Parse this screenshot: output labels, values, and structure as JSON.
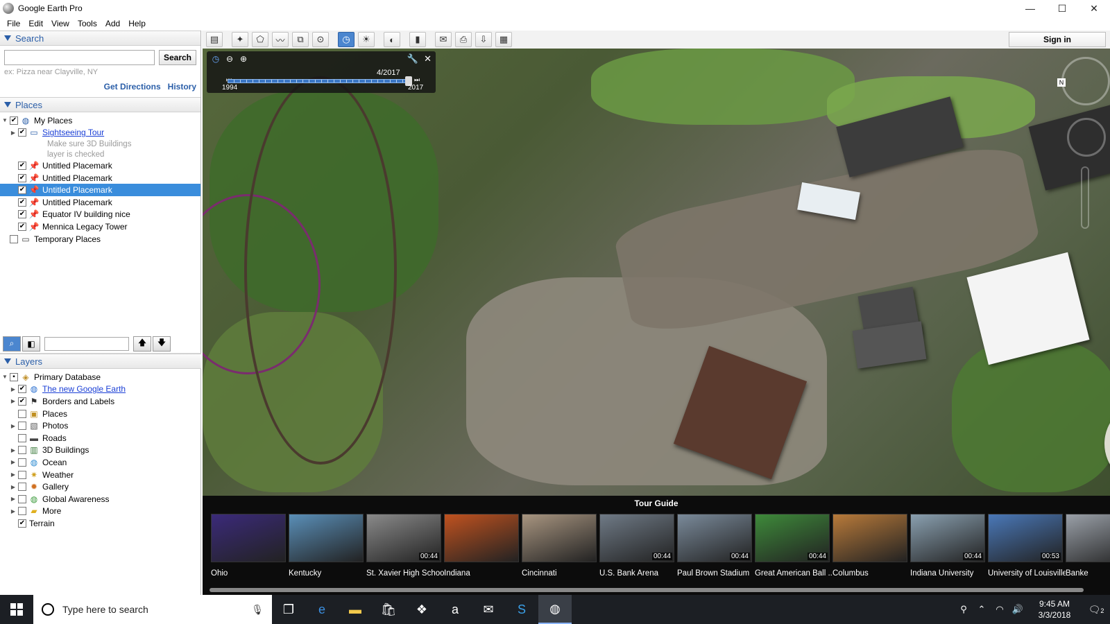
{
  "window": {
    "title": "Google Earth Pro",
    "controls": {
      "minimize": "—",
      "maximize": "☐",
      "close": "✕"
    }
  },
  "menu": [
    "File",
    "Edit",
    "View",
    "Tools",
    "Add",
    "Help"
  ],
  "search": {
    "header": "Search",
    "placeholder": "",
    "button": "Search",
    "hint": "ex: Pizza near Clayville, NY",
    "links": [
      "Get Directions",
      "History"
    ]
  },
  "places": {
    "header": "Places",
    "root": "My Places",
    "tour": "Sightseeing Tour",
    "tour_note_1": "Make sure 3D Buildings",
    "tour_note_2": "layer is checked",
    "items": [
      "Untitled Placemark",
      "Untitled Placemark",
      "Untitled Placemark",
      "Untitled Placemark",
      "Equator IV building nice",
      "Mennica Legacy Tower"
    ],
    "selected_index": 2,
    "temporary": "Temporary Places"
  },
  "layers": {
    "header": "Layers",
    "root": "Primary Database",
    "items": [
      {
        "label": "The new Google Earth",
        "link": true,
        "checked": true,
        "expandable": true,
        "icon": "globe-icon"
      },
      {
        "label": "Borders and Labels",
        "link": false,
        "checked": true,
        "expandable": true,
        "icon": "flag-icon"
      },
      {
        "label": "Places",
        "link": false,
        "checked": false,
        "expandable": false,
        "icon": "places-icon"
      },
      {
        "label": "Photos",
        "link": false,
        "checked": false,
        "expandable": true,
        "icon": "camera-icon"
      },
      {
        "label": "Roads",
        "link": false,
        "checked": false,
        "expandable": false,
        "icon": "road-icon"
      },
      {
        "label": "3D Buildings",
        "link": false,
        "checked": false,
        "expandable": true,
        "icon": "building-icon"
      },
      {
        "label": "Ocean",
        "link": false,
        "checked": false,
        "expandable": true,
        "icon": "ocean-icon"
      },
      {
        "label": "Weather",
        "link": false,
        "checked": false,
        "expandable": true,
        "icon": "weather-icon"
      },
      {
        "label": "Gallery",
        "link": false,
        "checked": false,
        "expandable": true,
        "icon": "gallery-icon"
      },
      {
        "label": "Global Awareness",
        "link": false,
        "checked": false,
        "expandable": true,
        "icon": "awareness-icon"
      },
      {
        "label": "More",
        "link": false,
        "checked": false,
        "expandable": true,
        "icon": "folder-icon"
      },
      {
        "label": "Terrain",
        "link": false,
        "checked": true,
        "expandable": false,
        "icon": ""
      }
    ]
  },
  "toolbar": {
    "sign_in": "Sign in"
  },
  "time_slider": {
    "date": "4/2017",
    "start": "1994",
    "end": "2017",
    "position": 1.0
  },
  "tour_guide": {
    "title": "Tour Guide",
    "items": [
      {
        "label": "Ohio",
        "duration": "",
        "color": "#3b2a7a"
      },
      {
        "label": "Kentucky",
        "duration": "",
        "color": "#5a8fb8"
      },
      {
        "label": "St. Xavier High School",
        "duration": "00:44",
        "color": "#8a8a8a"
      },
      {
        "label": "Indiana",
        "duration": "",
        "color": "#c0521f"
      },
      {
        "label": "Cincinnati",
        "duration": "",
        "color": "#a89580"
      },
      {
        "label": "U.S. Bank Arena",
        "duration": "00:44",
        "color": "#6f7a86"
      },
      {
        "label": "Paul Brown Stadium",
        "duration": "00:44",
        "color": "#7a8a9a"
      },
      {
        "label": "Great American Ball ...",
        "duration": "00:44",
        "color": "#3e8a3a"
      },
      {
        "label": "Columbus",
        "duration": "",
        "color": "#b87a3a"
      },
      {
        "label": "Indiana University",
        "duration": "00:44",
        "color": "#8aa0b0"
      },
      {
        "label": "University of Louisville",
        "duration": "00:53",
        "color": "#4a78b8"
      },
      {
        "label": "Banke",
        "duration": "",
        "color": "#9aa0a8"
      }
    ]
  },
  "taskbar": {
    "search_placeholder": "Type here to search",
    "time": "9:45 AM",
    "date": "3/3/2018",
    "notifications": "2"
  }
}
